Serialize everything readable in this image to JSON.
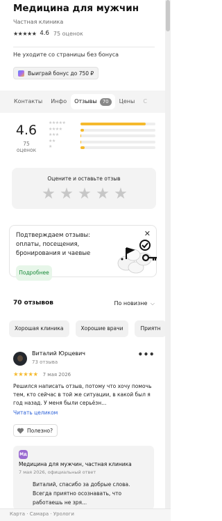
{
  "header": {
    "title": "Медицина для мужчин",
    "subtitle": "Частная клиника",
    "stars": "★★★★★",
    "rating": "4.6",
    "rating_count": "75 оценок"
  },
  "bonus": {
    "notice": "Не уходите со страницы без бонуса",
    "button_label": "Выиграй бонус до 750 ₽",
    "button_icon": "bonus-icon"
  },
  "tabs": {
    "items": [
      "Контакты",
      "Инфо",
      "Отзывы",
      "Цены",
      "С"
    ],
    "active": "Отзывы",
    "active_count": "70"
  },
  "summary": {
    "rating": "4.6",
    "count": "75 оценок",
    "distribution": [
      {
        "stars": "★★★★★",
        "fraction": 0.87
      },
      {
        "stars": "★★★★",
        "fraction": 0.05
      },
      {
        "stars": "★★★",
        "fraction": 0.01
      },
      {
        "stars": "★★",
        "fraction": 0.01
      },
      {
        "stars": "★",
        "fraction": 0.06
      }
    ],
    "bar_color": "#f5b92c"
  },
  "rate_box": {
    "label": "Оцените и оставьте отзыв",
    "star_glyph": "★"
  },
  "promo": {
    "text": "Подтверждаем отзывы: оплаты, посещения, бронирования и чаевые",
    "button_label": "Подробнее",
    "close_glyph": "✕"
  },
  "reviews_header": {
    "title": "70 отзывов",
    "sort_label": "По новизне",
    "sort_chevron": "⌵"
  },
  "chips": [
    "Хорошая клиника",
    "Хорошие врачи",
    "Приятн"
  ],
  "review": {
    "author": "Виталий Юрцевич",
    "author_sub": "73 отзыва",
    "more_glyph": "•••",
    "stars": "★★★★★",
    "date": "7 мая 2026",
    "text": "Решился написать отзыв, потому что хочу помочь тем, кто сейчас в той же ситуации, в какой был я год назад. У меня были серьёзн...",
    "read_more": "Читать целиком",
    "helpful": "Полезно?"
  },
  "reply": {
    "logo_text": "Мд",
    "name": "Медицина для мужчин, частная клиника",
    "sub": "7 мая 2026, официальный ответ",
    "text": "Виталий, спасибо за добрые слова. Всегда приятно осознавать, что работаешь не зря..."
  },
  "footer": {
    "breadcrumbs": "Карта · Самара · Урологи"
  }
}
